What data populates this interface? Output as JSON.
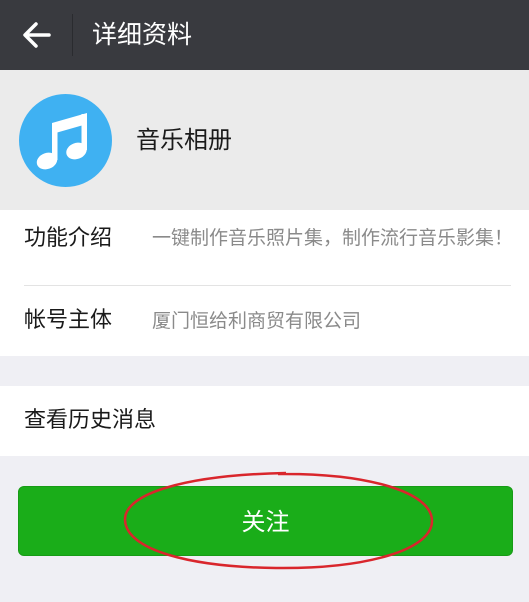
{
  "titlebar": {
    "back_icon": "arrow-left-icon",
    "title": "详细资料"
  },
  "header": {
    "avatar_icon": "music-note-icon",
    "account_name": "音乐相册"
  },
  "info": {
    "function_label": "功能介绍",
    "function_value": "一键制作音乐照片集，制作流行音乐影集！",
    "owner_label": "帐号主体",
    "owner_value": "厦门恒给利商贸有限公司"
  },
  "history": {
    "label": "查看历史消息"
  },
  "follow": {
    "label": "关注"
  },
  "colors": {
    "titlebar_bg": "#393a3f",
    "follow_green": "#1aad19",
    "avatar_blue": "#3fb1f2",
    "annotation_red": "#d9262c"
  }
}
